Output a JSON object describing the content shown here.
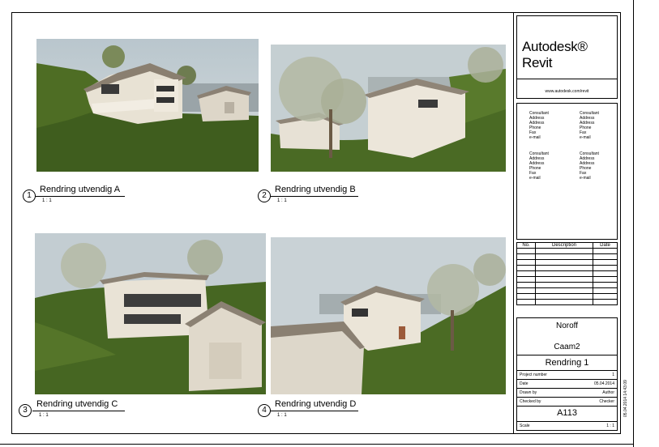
{
  "views": [
    {
      "number": "1",
      "title": "Rendring utvendig A",
      "scale": "1 : 1"
    },
    {
      "number": "2",
      "title": "Rendring utvendig B",
      "scale": "1 : 1"
    },
    {
      "number": "3",
      "title": "Rendring utvendig C",
      "scale": "1 : 1"
    },
    {
      "number": "4",
      "title": "Rendring utvendig D",
      "scale": "1 : 1"
    }
  ],
  "title_block": {
    "logo": "Autodesk® Revit",
    "website": "www.autodesk.com/revit",
    "consultants": [
      {
        "name": "Consultant",
        "address1": "Address",
        "address2": "Address",
        "phone": "Phone",
        "fax": "Fax",
        "email": "e-mail"
      },
      {
        "name": "Consultant",
        "address1": "Address",
        "address2": "Address",
        "phone": "Phone",
        "fax": "Fax",
        "email": "e-mail"
      },
      {
        "name": "Consultant",
        "address1": "Address",
        "address2": "Address",
        "phone": "Phone",
        "fax": "Fax",
        "email": "e-mail"
      },
      {
        "name": "Consultant",
        "address1": "Address",
        "address2": "Address",
        "phone": "Phone",
        "fax": "Fax",
        "email": "e-mail"
      }
    ],
    "revision_headers": [
      "No.",
      "Description",
      "Date"
    ],
    "owner": "Noroff",
    "project_name": "Caam2",
    "sheet_name": "Rendring 1",
    "fields": [
      {
        "label": "Project number",
        "value": "1"
      },
      {
        "label": "Date",
        "value": "05.04.2014"
      },
      {
        "label": "Drawn by",
        "value": "Author"
      },
      {
        "label": "Checked by",
        "value": "Checker"
      }
    ],
    "sheet_number": "A113",
    "scale_label": "Scale",
    "scale_value": "1 : 1",
    "timestamp": "05.04.2014 14:43:09"
  }
}
